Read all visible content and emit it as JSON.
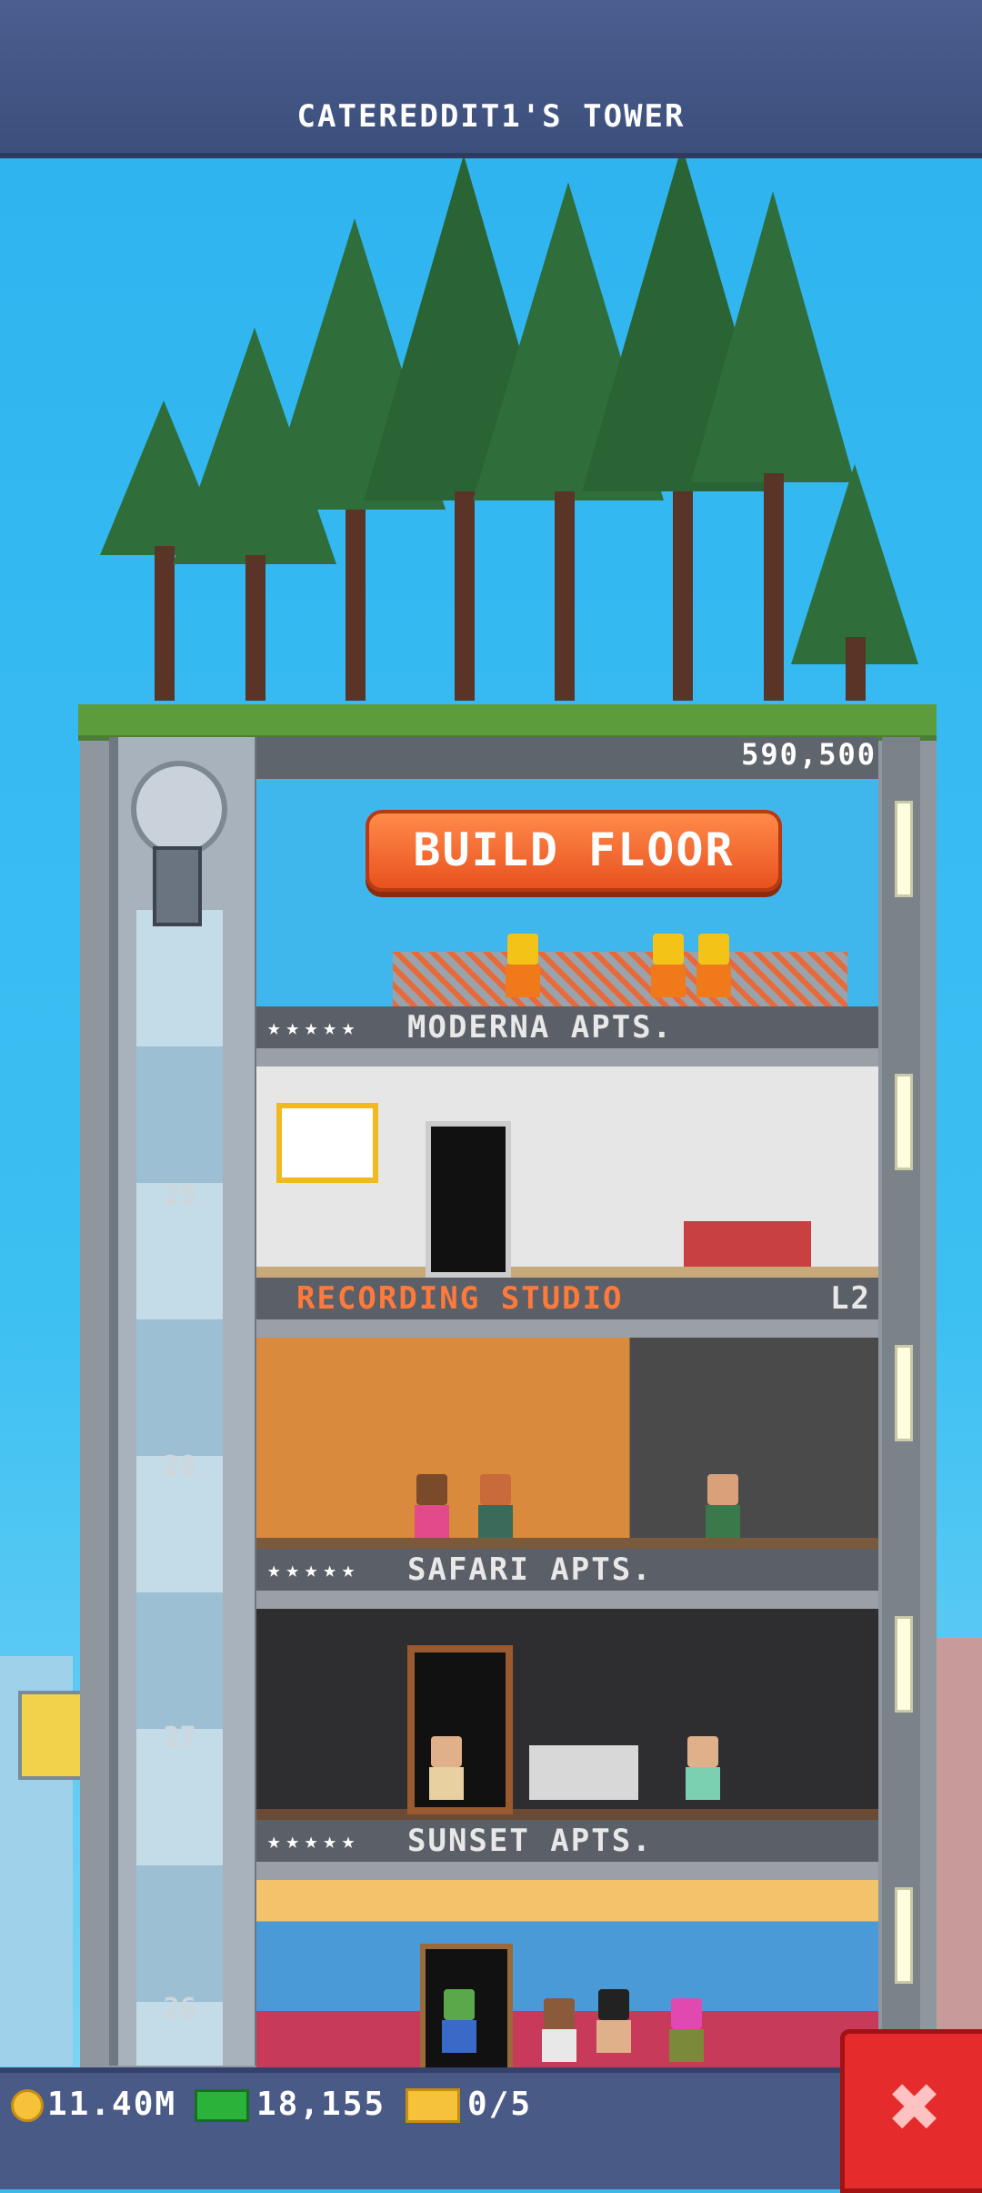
{
  "header": {
    "title": "CATEREDDIT1'S TOWER"
  },
  "tower": {
    "top_count": "590,500",
    "build_button_label": "BUILD FLOOR",
    "floors": [
      {
        "name": "MODERNA APTS.",
        "stars": "★★★★★",
        "level": "29"
      },
      {
        "name": "RECORDING STUDIO",
        "stars": "",
        "tag": "L2",
        "level": "28"
      },
      {
        "name": "SAFARI APTS.",
        "stars": "★★★★★",
        "level": "27"
      },
      {
        "name": "SUNSET APTS.",
        "stars": "★★★★★",
        "level": "26"
      }
    ]
  },
  "status_bar": {
    "coins": "11.40M",
    "bux": "18,155",
    "tickets": "0/5"
  },
  "icons": {
    "coin": "coin-icon",
    "bux": "bux-icon",
    "ticket": "ticket-icon",
    "close": "close-icon"
  },
  "colors": {
    "build_button": "#e9521f",
    "close_button": "#e52b2b",
    "label_text_orange": "#ff7a3a"
  }
}
